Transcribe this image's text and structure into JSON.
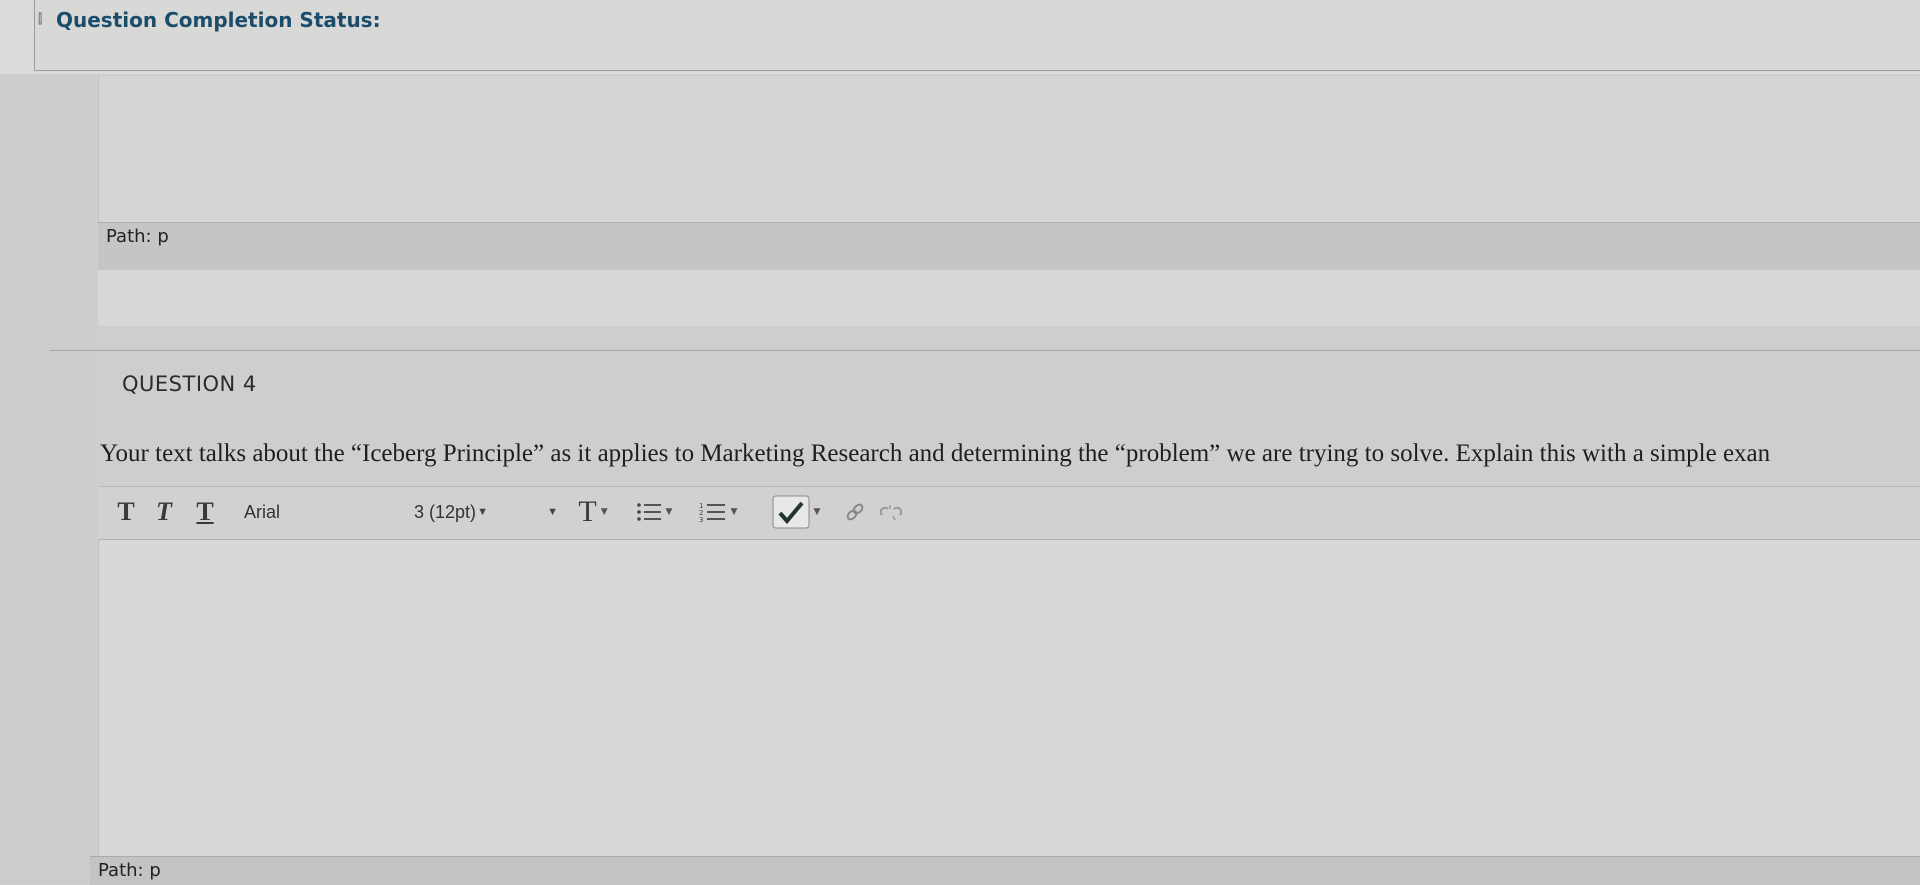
{
  "status": {
    "title": "Question Completion Status:"
  },
  "editor1": {
    "path_label": "Path: p"
  },
  "question": {
    "heading": "QUESTION 4",
    "text": "Your text talks about the “Iceberg Principle” as it applies to Marketing Research and determining the “problem” we are trying to solve. Explain this with a simple exan"
  },
  "toolbar": {
    "bold_label": "T",
    "italic_label": "T",
    "underline_label": "T",
    "font_family": "Arial",
    "font_size": "3 (12pt)",
    "text_color_label": "T"
  },
  "editor2": {
    "path_label": "Path: p"
  },
  "icons": [
    "chevron-down-icon",
    "bold-icon",
    "italic-icon",
    "underline-icon",
    "text-color-icon",
    "bullet-list-icon",
    "numbered-list-icon",
    "spellcheck-icon",
    "link-icon",
    "unlink-icon"
  ]
}
